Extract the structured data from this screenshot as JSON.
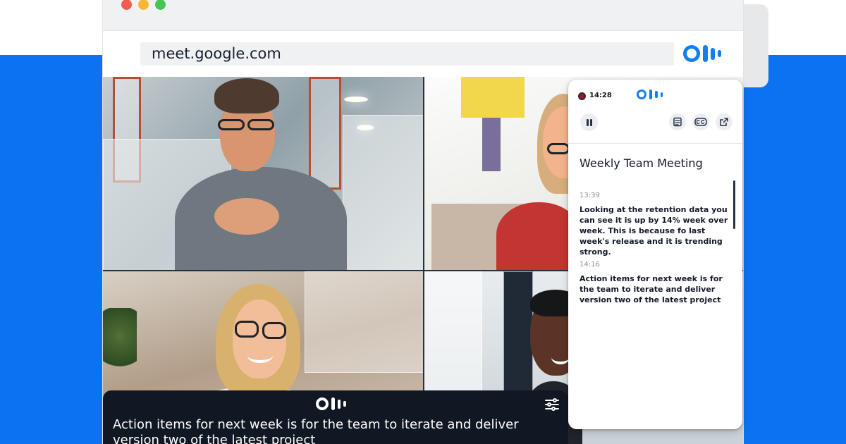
{
  "browser": {
    "address": "meet.google.com"
  },
  "caption_bar": {
    "text": "Action items for next week is for the team to iterate and deliver version two of the latest project"
  },
  "panel": {
    "record_time": "14:28",
    "meeting_title": "Weekly Team Meeting",
    "transcript": [
      {
        "time": "13:39",
        "text": "Looking at the retention data you can see it is up by 14% week over week. This is because fo last week's release and it is trending strong."
      },
      {
        "time": "14:16",
        "text": "Action items for next week is for the team to iterate and deliver version two of the latest project"
      }
    ]
  },
  "colors": {
    "background_blue": "#0d72f2",
    "brand_blue": "#137df3",
    "caption_background": "#101823",
    "record_red": "#a61226"
  },
  "icons": {
    "brand": "otter-logo-icon",
    "record": "recording-dot-icon",
    "pause": "pause-icon",
    "notes": "notes-icon",
    "captions": "closed-captions-icon",
    "open": "open-external-icon",
    "settings": "caption-settings-icon"
  }
}
